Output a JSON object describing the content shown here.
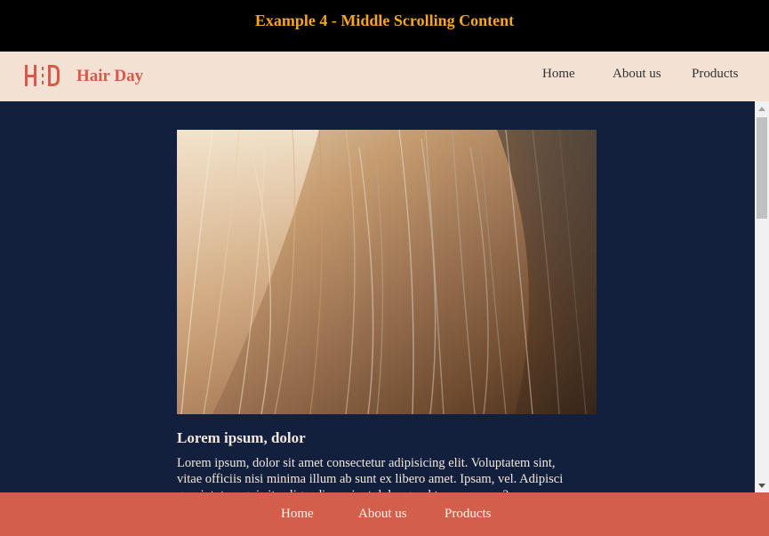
{
  "banner": {
    "title": "Example 4 - Middle Scrolling Content"
  },
  "header": {
    "brand": "Hair Day",
    "logo_letters": "HD",
    "nav": [
      {
        "label": "Home"
      },
      {
        "label": "About us"
      },
      {
        "label": "Products"
      }
    ]
  },
  "content": {
    "image_alt": "close-up photo of blonde hair",
    "title": "Lorem ipsum, dolor",
    "text": "Lorem ipsum, dolor sit amet consectetur adipisicing elit. Voluptatem sint, vitae officiis nisi minima illum ab sunt ex libero amet. Ipsam, vel. Adipisci quasi, totam quis ita eligendi nesciunt dolor quod tempora vero?"
  },
  "footer": {
    "nav": [
      {
        "label": "Home"
      },
      {
        "label": "About us"
      },
      {
        "label": "Products"
      }
    ]
  },
  "colors": {
    "banner_bg": "#000000",
    "banner_text": "#f5a623",
    "header_bg": "#f3e1d3",
    "brand": "#cf5d4a",
    "content_bg": "#121f3d",
    "footer_bg": "#d25e4b"
  },
  "icons": {
    "logo": "hd-logo-icon",
    "scroll_up": "chevron-up-icon",
    "scroll_down": "chevron-down-icon"
  }
}
